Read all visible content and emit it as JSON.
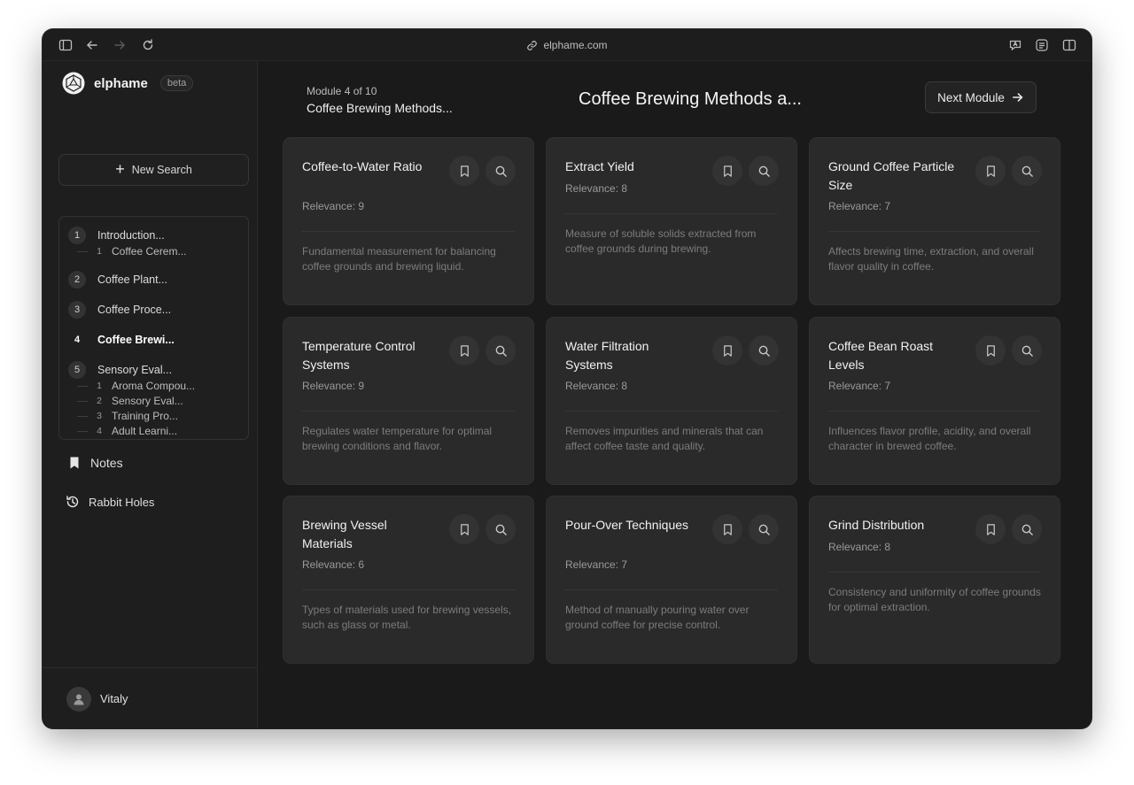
{
  "browser": {
    "url": "elphame.com"
  },
  "sidebar": {
    "brand": "elphame",
    "badge": "beta",
    "new_search": "New Search",
    "modules": [
      {
        "num": "1",
        "label": "Introduction..."
      },
      {
        "num": "2",
        "label": "Coffee Plant..."
      },
      {
        "num": "3",
        "label": "Coffee Proce..."
      },
      {
        "num": "4",
        "label": "Coffee Brewi..."
      },
      {
        "num": "5",
        "label": "Sensory Eval..."
      }
    ],
    "submodules_1": [
      {
        "num": "1",
        "label": "Coffee Cerem..."
      }
    ],
    "submodules_5": [
      {
        "num": "1",
        "label": "Aroma Compou..."
      },
      {
        "num": "2",
        "label": "Sensory Eval..."
      },
      {
        "num": "3",
        "label": "Training Pro..."
      },
      {
        "num": "4",
        "label": "Adult Learni..."
      }
    ],
    "notes": "Notes",
    "rabbit_holes": "Rabbit Holes",
    "user": "Vitaly"
  },
  "header": {
    "module_count": "Module 4 of 10",
    "module_name": "Coffee Brewing Methods...",
    "title": "Coffee Brewing Methods a...",
    "next_button": "Next Module"
  },
  "cards": [
    {
      "title": "Coffee-to-Water Ratio",
      "relevance": "Relevance: 9",
      "description": "Fundamental measurement for balancing coffee grounds and brewing liquid."
    },
    {
      "title": "Extract Yield",
      "relevance": "Relevance: 8",
      "description": "Measure of soluble solids extracted from coffee grounds during brewing."
    },
    {
      "title": "Ground Coffee Particle Size",
      "relevance": "Relevance: 7",
      "description": "Affects brewing time, extraction, and overall flavor quality in coffee."
    },
    {
      "title": "Temperature Control Systems",
      "relevance": "Relevance: 9",
      "description": "Regulates water temperature for optimal brewing conditions and flavor."
    },
    {
      "title": "Water Filtration Systems",
      "relevance": "Relevance: 8",
      "description": "Removes impurities and minerals that can affect coffee taste and quality."
    },
    {
      "title": "Coffee Bean Roast Levels",
      "relevance": "Relevance: 7",
      "description": "Influences flavor profile, acidity, and overall character in brewed coffee."
    },
    {
      "title": "Brewing Vessel Materials",
      "relevance": "Relevance: 6",
      "description": "Types of materials used for brewing vessels, such as glass or metal."
    },
    {
      "title": "Pour-Over Techniques",
      "relevance": "Relevance: 7",
      "description": "Method of manually pouring water over ground coffee for precise control."
    },
    {
      "title": "Grind Distribution",
      "relevance": "Relevance: 8",
      "description": "Consistency and uniformity of coffee grounds for optimal extraction."
    }
  ],
  "icons": {
    "bookmark": "bookmark-icon",
    "search": "search-icon",
    "arrow": "arrow-right-icon"
  }
}
